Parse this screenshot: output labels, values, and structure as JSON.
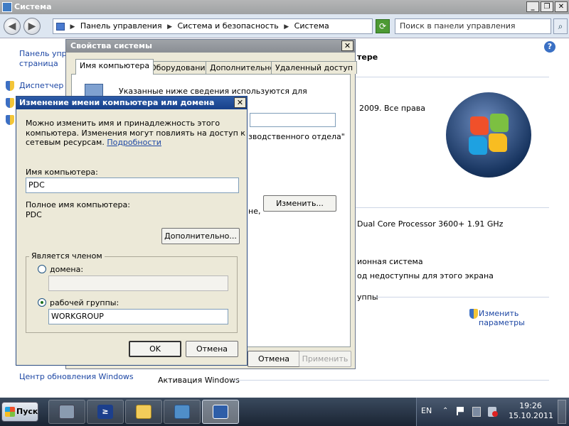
{
  "window": {
    "title": "Система",
    "address": {
      "part1": "Панель управления",
      "part2": "Система и безопасность",
      "part3": "Система"
    },
    "search_placeholder": "Поиск в панели управления",
    "left_pane": {
      "home_link_line1": "Панель упра",
      "home_link_line2": "страница",
      "device_manager": "Диспетчер у",
      "windows_update": "Центр обновления Windows"
    },
    "right": {
      "heading_fragment": "тере",
      "copyright_fragment": "2009. Все права",
      "processor_fragment": "Dual Core Processor 3600+   1.91 GHz",
      "os_fragment": "ионная система",
      "touch_fragment": "од недоступны для этого экрана",
      "group_fragment": "уппы",
      "change_params_line1": "Изменить",
      "change_params_line2": "параметры",
      "activation": "Активация Windows"
    }
  },
  "sysprops": {
    "title": "Свойства системы",
    "tabs": [
      "Имя компьютера",
      "Оборудование",
      "Дополнительно",
      "Удаленный доступ"
    ],
    "info_text": "Указанные ниже сведения используются для",
    "dept_fragment": "зводственного отдела\"",
    "ne_fragment": "не,",
    "change_button": "Изменить...",
    "cancel_button": "Отмена",
    "apply_button": "Применить"
  },
  "rename": {
    "title": "Изменение имени компьютера или домена",
    "desc_line1": "Можно изменить имя и принадлежность этого",
    "desc_line2": "компьютера. Изменения могут повлиять на доступ к",
    "desc_line3": "сетевым ресурсам.",
    "details_link": "Подробности",
    "computer_name_label": "Имя компьютера:",
    "computer_name_value": "PDC",
    "full_name_label": "Полное имя компьютера:",
    "full_name_value": "PDC",
    "more_button": "Дополнительно...",
    "member_of_label": "Является членом",
    "domain_label": "домена:",
    "domain_value": "",
    "workgroup_label": "рабочей группы:",
    "workgroup_value": "WORKGROUP",
    "ok_button": "OK",
    "cancel_button": "Отмена"
  },
  "taskbar": {
    "start_label": "Пуск",
    "language": "EN",
    "time": "19:26",
    "date": "15.10.2011"
  }
}
